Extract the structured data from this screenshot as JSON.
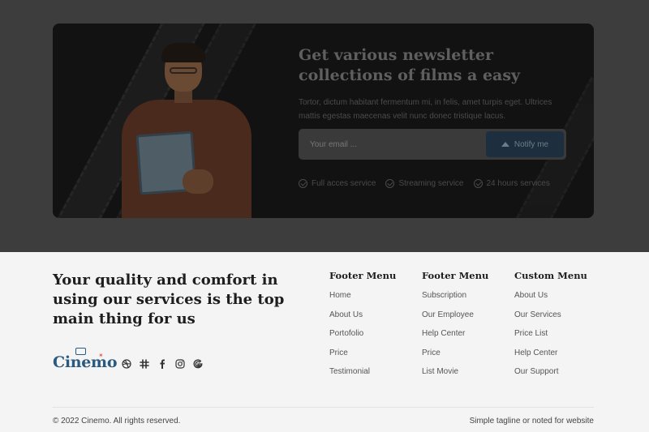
{
  "newsletter": {
    "title": "Get various newsletter collections of films a easy",
    "description": "Tortor, dictum habitant fermentum mi, in felis, amet turpis eget. Ultrices mattis egestas maecenas velit nunc donec tristique lacus.",
    "email_placeholder": "Your email ...",
    "button_label": "Notify me",
    "features": [
      "Full acces service",
      "Streaming service",
      "24 hours services"
    ]
  },
  "footer": {
    "tagline": "Your quality and comfort in using our services is the top main thing for us",
    "logo_text": "Cinemo",
    "socials": [
      "dribbble-icon",
      "slack-icon",
      "facebook-icon",
      "instagram-icon",
      "google-icon"
    ],
    "columns": [
      {
        "title": "Footer Menu",
        "items": [
          "Home",
          "About Us",
          "Portofolio",
          "Price",
          "Testimonial"
        ]
      },
      {
        "title": "Footer Menu",
        "items": [
          "Subscription",
          "Our Employee",
          "Help Center",
          "Price",
          "List Movie"
        ]
      },
      {
        "title": "Custom Menu",
        "items": [
          "About Us",
          "Our Services",
          "Price List",
          "Help Center",
          "Our Support"
        ]
      }
    ],
    "copyright": "© 2022 Cinemo. All rights reserved.",
    "note": "Simple tagline or noted for website"
  },
  "colors": {
    "brand": "#2b5a80",
    "overlay": "#3d3d3d",
    "button": "#1d2f3f"
  }
}
